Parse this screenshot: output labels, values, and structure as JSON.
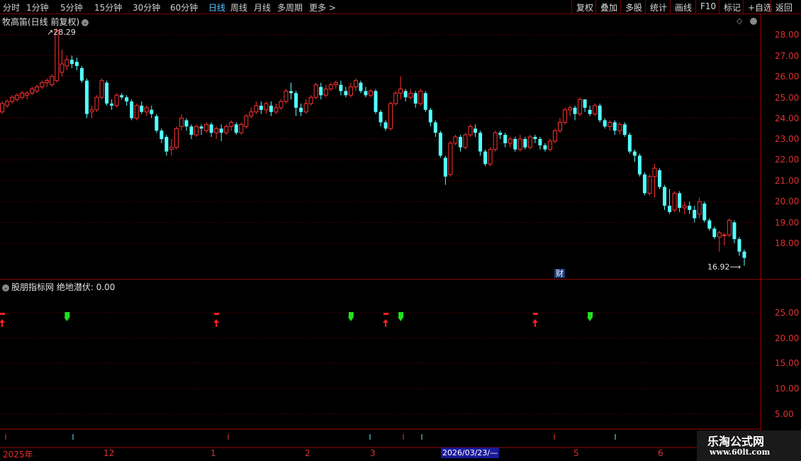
{
  "toolbar": {
    "periods": [
      "分时",
      "1分钟",
      "5分钟",
      "15分钟",
      "30分钟",
      "60分钟",
      "日线",
      "周线",
      "月线",
      "多周期",
      "更多 >"
    ],
    "right_buttons": [
      "复权",
      "叠加",
      "多股",
      "统计",
      "画线",
      "F10",
      "标记",
      "+自选",
      "返回"
    ]
  },
  "main_chart": {
    "title": "牧高笛(日线 前复权)",
    "high_label": "28.29",
    "low_label": "16.92",
    "cai_badge": "财",
    "y_axis": [
      "28.00",
      "27.00",
      "26.00",
      "25.00",
      "24.00",
      "23.00",
      "22.00",
      "21.00",
      "20.00",
      "19.00",
      "18.00"
    ],
    "colors": {
      "up": "#ff3232",
      "down": "#54ffff",
      "grid": "#7a0000",
      "axis": "#e03030"
    }
  },
  "indicator": {
    "title": "股朋指标网 绝地潜伏: 0.00",
    "y_axis": [
      "25.00",
      "20.00",
      "15.00",
      "10.00",
      "5.00"
    ]
  },
  "date_axis": {
    "labels": [
      "2025年",
      "12",
      "1",
      "2",
      "3",
      "5",
      "6"
    ],
    "highlight": "2026/03/23/—"
  },
  "watermark": {
    "title": "乐淘公式网",
    "url": "www.60lt.com"
  },
  "chart_data": {
    "type": "candlestick",
    "ylim": [
      16.5,
      28.7
    ],
    "candles": [
      [
        24.3,
        24.7,
        24.2,
        24.8
      ],
      [
        24.6,
        24.8,
        24.5,
        24.9
      ],
      [
        24.8,
        25.0,
        24.7,
        25.1
      ],
      [
        24.9,
        25.1,
        24.8,
        25.2
      ],
      [
        25.0,
        25.2,
        24.9,
        25.3
      ],
      [
        25.1,
        25.2,
        24.9,
        25.3
      ],
      [
        25.2,
        25.4,
        25.1,
        25.5
      ],
      [
        25.3,
        25.5,
        25.2,
        25.6
      ],
      [
        25.5,
        25.7,
        25.4,
        25.8
      ],
      [
        25.7,
        25.8,
        25.5,
        25.9
      ],
      [
        25.6,
        26.0,
        25.5,
        26.1
      ],
      [
        25.8,
        28.2,
        25.7,
        28.29
      ],
      [
        26.2,
        26.6,
        26.0,
        27.3
      ],
      [
        26.5,
        26.8,
        26.3,
        27.0
      ],
      [
        26.8,
        26.6,
        26.4,
        27.0
      ],
      [
        26.7,
        26.5,
        26.3,
        26.9
      ],
      [
        26.4,
        25.8,
        25.7,
        26.5
      ],
      [
        25.8,
        24.2,
        24.0,
        25.9
      ],
      [
        24.3,
        24.4,
        24.0,
        24.6
      ],
      [
        24.4,
        25.0,
        24.3,
        25.1
      ],
      [
        25.0,
        25.8,
        24.9,
        25.9
      ],
      [
        25.7,
        24.7,
        24.6,
        25.8
      ],
      [
        24.7,
        24.6,
        24.4,
        24.9
      ],
      [
        24.6,
        25.1,
        24.5,
        25.2
      ],
      [
        25.1,
        25.0,
        24.9,
        25.2
      ],
      [
        25.0,
        24.8,
        24.6,
        25.1
      ],
      [
        24.8,
        24.0,
        23.9,
        24.9
      ],
      [
        24.0,
        24.6,
        23.9,
        24.7
      ],
      [
        24.6,
        24.3,
        24.2,
        24.8
      ],
      [
        24.3,
        24.5,
        24.1,
        24.6
      ],
      [
        24.4,
        24.2,
        24.0,
        24.6
      ],
      [
        24.1,
        23.4,
        23.3,
        24.2
      ],
      [
        23.4,
        23.0,
        22.8,
        23.5
      ],
      [
        23.1,
        22.4,
        22.2,
        23.2
      ],
      [
        22.5,
        22.6,
        22.2,
        23.0
      ],
      [
        22.6,
        23.5,
        22.5,
        23.6
      ],
      [
        23.6,
        24.0,
        23.4,
        24.2
      ],
      [
        23.9,
        23.6,
        23.4,
        24.0
      ],
      [
        23.6,
        23.2,
        23.0,
        23.7
      ],
      [
        23.2,
        23.6,
        23.1,
        23.7
      ],
      [
        23.6,
        23.5,
        23.2,
        23.7
      ],
      [
        23.4,
        23.7,
        23.3,
        23.8
      ],
      [
        23.7,
        23.3,
        23.1,
        23.8
      ],
      [
        23.3,
        23.5,
        23.0,
        23.6
      ],
      [
        23.5,
        23.3,
        22.9,
        23.7
      ],
      [
        23.3,
        23.6,
        23.2,
        23.7
      ],
      [
        23.6,
        23.8,
        23.4,
        23.9
      ],
      [
        23.7,
        23.3,
        23.2,
        23.8
      ],
      [
        23.3,
        23.7,
        23.2,
        23.8
      ],
      [
        23.6,
        24.1,
        23.5,
        24.2
      ],
      [
        24.1,
        24.3,
        24.0,
        24.5
      ],
      [
        24.3,
        24.6,
        24.2,
        24.8
      ],
      [
        24.6,
        24.4,
        24.2,
        24.8
      ],
      [
        24.4,
        24.7,
        24.2,
        24.8
      ],
      [
        24.6,
        24.3,
        24.1,
        24.8
      ],
      [
        24.3,
        24.5,
        24.2,
        24.7
      ],
      [
        24.5,
        24.8,
        24.4,
        24.9
      ],
      [
        24.8,
        25.3,
        24.7,
        25.4
      ],
      [
        25.3,
        25.2,
        24.9,
        25.7
      ],
      [
        25.2,
        24.5,
        24.1,
        25.3
      ],
      [
        24.5,
        24.3,
        24.1,
        24.7
      ],
      [
        24.3,
        24.7,
        24.2,
        24.9
      ],
      [
        24.7,
        25.0,
        24.6,
        25.1
      ],
      [
        25.0,
        25.6,
        24.9,
        25.7
      ],
      [
        25.5,
        25.1,
        24.9,
        25.7
      ],
      [
        25.1,
        25.4,
        25.0,
        25.6
      ],
      [
        25.4,
        25.6,
        25.3,
        25.7
      ],
      [
        25.6,
        25.7,
        25.4,
        25.8
      ],
      [
        25.6,
        25.3,
        25.1,
        25.8
      ],
      [
        25.3,
        25.1,
        25.0,
        25.5
      ],
      [
        25.1,
        25.5,
        25.0,
        25.7
      ],
      [
        25.5,
        25.8,
        25.3,
        25.9
      ],
      [
        25.7,
        25.3,
        25.2,
        25.8
      ],
      [
        25.3,
        25.1,
        25.0,
        25.5
      ],
      [
        25.1,
        25.3,
        25.0,
        25.4
      ],
      [
        25.3,
        24.3,
        24.2,
        25.4
      ],
      [
        24.3,
        23.8,
        23.6,
        24.4
      ],
      [
        23.8,
        23.5,
        23.4,
        23.9
      ],
      [
        23.5,
        24.7,
        23.4,
        24.8
      ],
      [
        24.7,
        25.2,
        24.6,
        25.3
      ],
      [
        25.2,
        25.4,
        24.9,
        26.0
      ],
      [
        25.3,
        25.0,
        24.8,
        25.4
      ],
      [
        25.0,
        25.2,
        24.9,
        25.4
      ],
      [
        25.2,
        24.7,
        24.5,
        25.3
      ],
      [
        24.7,
        25.3,
        24.6,
        25.4
      ],
      [
        25.2,
        24.4,
        24.3,
        25.3
      ],
      [
        24.4,
        23.8,
        23.6,
        24.5
      ],
      [
        23.8,
        23.3,
        23.1,
        23.9
      ],
      [
        23.3,
        22.2,
        22.1,
        23.4
      ],
      [
        22.1,
        21.2,
        20.8,
        22.2
      ],
      [
        21.3,
        22.8,
        21.2,
        22.9
      ],
      [
        22.8,
        23.1,
        22.7,
        23.2
      ],
      [
        23.1,
        22.6,
        22.4,
        23.2
      ],
      [
        22.6,
        23.2,
        22.5,
        23.3
      ],
      [
        23.2,
        23.6,
        23.1,
        23.7
      ],
      [
        23.5,
        23.3,
        23.1,
        23.7
      ],
      [
        23.3,
        22.4,
        22.2,
        23.4
      ],
      [
        22.4,
        21.8,
        21.7,
        22.5
      ],
      [
        21.8,
        22.5,
        21.7,
        22.6
      ],
      [
        22.5,
        23.3,
        22.4,
        23.4
      ],
      [
        23.3,
        23.2,
        23.0,
        23.4
      ],
      [
        23.2,
        22.8,
        22.6,
        23.3
      ],
      [
        22.8,
        23.0,
        22.6,
        23.1
      ],
      [
        23.0,
        22.5,
        22.4,
        23.1
      ],
      [
        22.5,
        23.0,
        22.4,
        23.2
      ],
      [
        23.0,
        22.6,
        22.5,
        23.1
      ],
      [
        22.6,
        23.1,
        22.5,
        23.2
      ],
      [
        23.1,
        23.0,
        22.8,
        23.2
      ],
      [
        23.0,
        22.7,
        22.5,
        23.1
      ],
      [
        22.7,
        22.5,
        22.4,
        22.8
      ],
      [
        22.5,
        22.9,
        22.4,
        23.0
      ],
      [
        22.9,
        23.4,
        22.8,
        23.5
      ],
      [
        23.4,
        23.8,
        23.3,
        24.0
      ],
      [
        23.8,
        24.4,
        23.7,
        24.5
      ],
      [
        24.4,
        24.5,
        24.1,
        24.6
      ],
      [
        24.5,
        24.2,
        23.9,
        24.6
      ],
      [
        24.2,
        24.9,
        24.1,
        25.0
      ],
      [
        24.9,
        24.5,
        24.3,
        24.9
      ],
      [
        24.4,
        24.2,
        24.1,
        24.6
      ],
      [
        24.2,
        24.6,
        24.1,
        24.7
      ],
      [
        24.6,
        23.9,
        23.8,
        24.7
      ],
      [
        23.9,
        23.6,
        23.5,
        24.0
      ],
      [
        23.6,
        23.8,
        23.4,
        23.9
      ],
      [
        23.8,
        23.4,
        23.2,
        23.9
      ],
      [
        23.4,
        23.7,
        23.2,
        23.8
      ],
      [
        23.7,
        23.2,
        23.1,
        23.8
      ],
      [
        23.2,
        22.4,
        22.3,
        23.3
      ],
      [
        22.4,
        22.2,
        21.9,
        22.5
      ],
      [
        22.2,
        21.3,
        21.2,
        22.3
      ],
      [
        21.3,
        20.4,
        20.3,
        21.4
      ],
      [
        20.4,
        21.2,
        20.3,
        21.3
      ],
      [
        21.2,
        21.6,
        20.2,
        21.8
      ],
      [
        21.5,
        20.7,
        20.6,
        21.6
      ],
      [
        20.7,
        19.8,
        19.6,
        20.8
      ],
      [
        19.8,
        19.5,
        19.4,
        20.6
      ],
      [
        19.6,
        20.4,
        19.5,
        20.5
      ],
      [
        20.4,
        19.7,
        19.5,
        20.5
      ],
      [
        19.7,
        19.8,
        19.4,
        20.0
      ],
      [
        19.8,
        19.6,
        19.4,
        20.0
      ],
      [
        19.6,
        19.2,
        19.0,
        19.8
      ],
      [
        19.4,
        20.0,
        19.2,
        20.2
      ],
      [
        19.9,
        19.1,
        19.0,
        20.0
      ],
      [
        19.1,
        18.7,
        18.6,
        19.2
      ],
      [
        18.7,
        18.3,
        18.2,
        18.8
      ],
      [
        18.3,
        18.5,
        17.6,
        18.6
      ],
      [
        18.4,
        18.4,
        17.9,
        18.5
      ],
      [
        18.4,
        19.1,
        18.3,
        19.2
      ],
      [
        19.0,
        18.2,
        18.0,
        19.1
      ],
      [
        18.2,
        17.6,
        17.4,
        18.3
      ],
      [
        17.6,
        17.3,
        16.92,
        17.7
      ]
    ],
    "signals": [
      {
        "index": 0,
        "type": "buy"
      },
      {
        "index": 13,
        "type": "sell"
      },
      {
        "index": 43,
        "type": "buy"
      },
      {
        "index": 70,
        "type": "sell"
      },
      {
        "index": 77,
        "type": "buy"
      },
      {
        "index": 80,
        "type": "sell"
      },
      {
        "index": 107,
        "type": "buy"
      },
      {
        "index": 118,
        "type": "sell"
      }
    ]
  }
}
